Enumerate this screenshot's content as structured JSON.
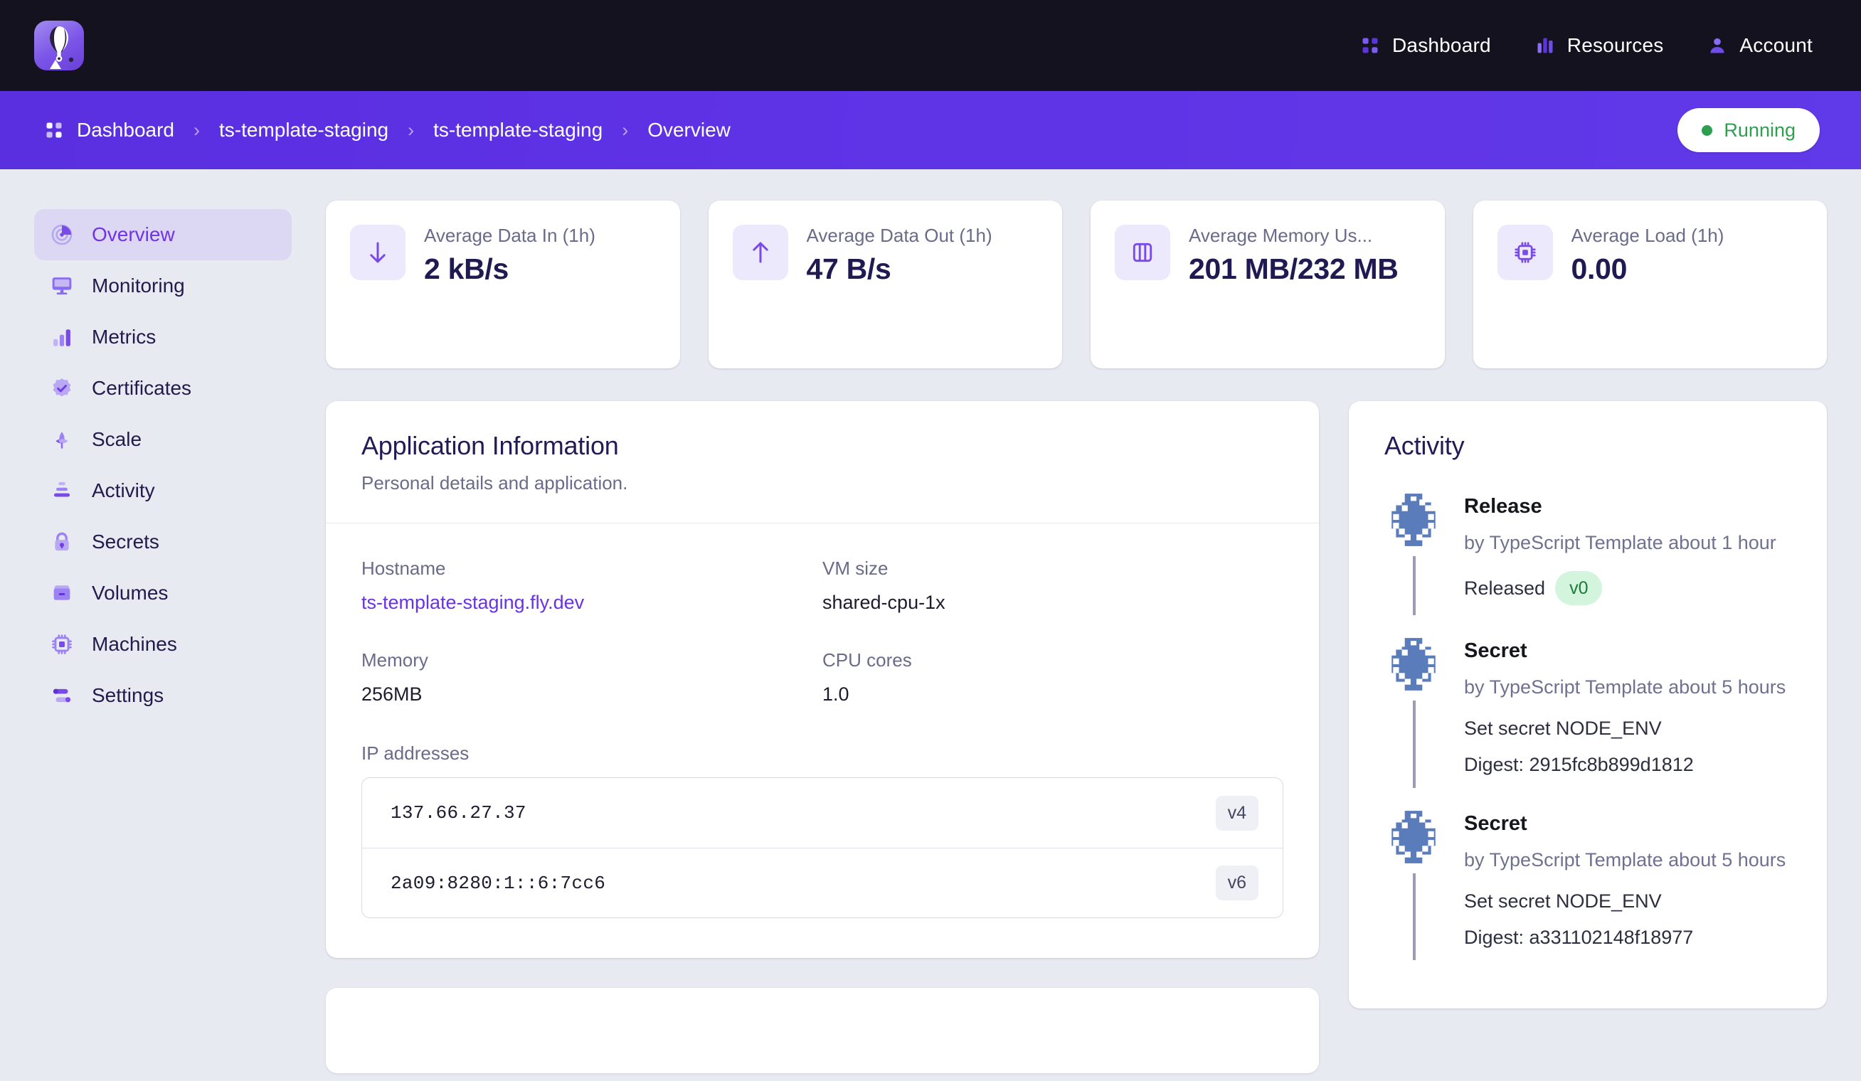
{
  "topnav": {
    "logo_name": "fly-balloon-logo",
    "links": [
      {
        "label": "Dashboard",
        "icon": "grid-icon"
      },
      {
        "label": "Resources",
        "icon": "bar-chart-icon"
      },
      {
        "label": "Account",
        "icon": "user-icon"
      }
    ]
  },
  "breadcrumb": {
    "items": [
      {
        "label": "Dashboard"
      },
      {
        "label": "ts-template-staging"
      },
      {
        "label": "ts-template-staging"
      },
      {
        "label": "Overview"
      }
    ],
    "separator": "›",
    "status": {
      "label": "Running",
      "color": "#2e9e4f"
    }
  },
  "sidebar": {
    "items": [
      {
        "label": "Overview",
        "icon": "pie-chart-icon",
        "active": true
      },
      {
        "label": "Monitoring",
        "icon": "monitor-icon",
        "active": false
      },
      {
        "label": "Metrics",
        "icon": "bar-chart-icon",
        "active": false
      },
      {
        "label": "Certificates",
        "icon": "badge-check-icon",
        "active": false
      },
      {
        "label": "Scale",
        "icon": "sprout-icon",
        "active": false
      },
      {
        "label": "Activity",
        "icon": "stack-icon",
        "active": false
      },
      {
        "label": "Secrets",
        "icon": "lock-icon",
        "active": false
      },
      {
        "label": "Volumes",
        "icon": "box-icon",
        "active": false
      },
      {
        "label": "Machines",
        "icon": "cpu-icon",
        "active": false
      },
      {
        "label": "Settings",
        "icon": "sliders-icon",
        "active": false
      }
    ]
  },
  "stats": [
    {
      "label": "Average Data In (1h)",
      "value": "2 kB/s",
      "icon": "arrow-down-icon"
    },
    {
      "label": "Average Data Out (1h)",
      "value": "47 B/s",
      "icon": "arrow-up-icon"
    },
    {
      "label": "Average Memory Us...",
      "value": "201 MB/232 MB",
      "icon": "memory-icon"
    },
    {
      "label": "Average Load (1h)",
      "value": "0.00",
      "icon": "cpu-icon"
    }
  ],
  "app_info": {
    "title": "Application Information",
    "subtitle": "Personal details and application.",
    "fields": [
      {
        "label": "Hostname",
        "value": "ts-template-staging.fly.dev",
        "link": true
      },
      {
        "label": "VM size",
        "value": "shared-cpu-1x",
        "link": false
      },
      {
        "label": "Memory",
        "value": "256MB",
        "link": false
      },
      {
        "label": "CPU cores",
        "value": "1.0",
        "link": false
      }
    ],
    "ip_label": "IP addresses",
    "ips": [
      {
        "addr": "137.66.27.37",
        "tag": "v4"
      },
      {
        "addr": "2a09:8280:1::6:7cc6",
        "tag": "v6"
      }
    ]
  },
  "activity": {
    "title": "Activity",
    "items": [
      {
        "kind": "Release",
        "meta": "by TypeScript Template about 1 hour",
        "detail": "Released",
        "badge": "v0",
        "detail2": ""
      },
      {
        "kind": "Secret",
        "meta": "by TypeScript Template about 5 hours",
        "detail": "Set secret NODE_ENV",
        "badge": "",
        "detail2": "Digest: 2915fc8b899d1812"
      },
      {
        "kind": "Secret",
        "meta": "by TypeScript Template about 5 hours",
        "detail": "Set secret NODE_ENV",
        "badge": "",
        "detail2": "Digest: a331102148f18977"
      }
    ]
  },
  "colors": {
    "brand_purple": "#5a2fe0",
    "nav_dark": "#15121f",
    "page_bg": "#e8eaf2",
    "accent_violet": "#7033e6",
    "status_green": "#2e9e4f"
  }
}
